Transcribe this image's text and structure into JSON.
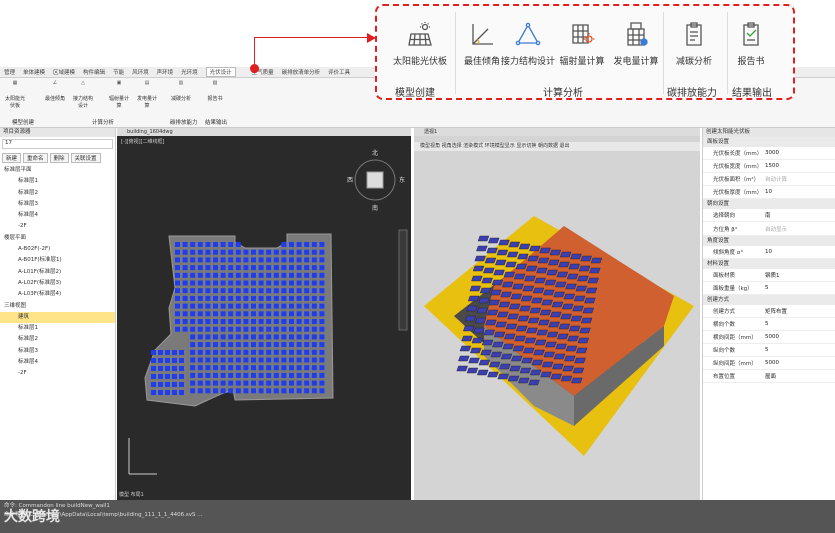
{
  "tabs": [
    "管理",
    "单体建模",
    "区域建模",
    "构件编辑",
    "节能",
    "风环境",
    "声环境",
    "光环境",
    "光伏设计",
    "",
    "室气质量",
    "碳排放清单分析",
    "评价工具"
  ],
  "ribbon": {
    "buttons": [
      "太阳能光伏板",
      "最佳倾角",
      "接力结构设计",
      "辐射量计算",
      "发电量计算",
      "减碳分析",
      "报告书"
    ],
    "groups": [
      "模型创建",
      "计算分析",
      "碳排放能力",
      "结果输出"
    ]
  },
  "zoom": {
    "buttons": [
      "太阳能光伏板",
      "最佳倾角",
      "接力结构设计",
      "辐射量计算",
      "发电量计算",
      "减碳分析",
      "报告书"
    ],
    "groups": [
      "模型创建",
      "计算分析",
      "碳排放能力",
      "结果输出"
    ]
  },
  "left": {
    "title": "项目资源器",
    "field": "17",
    "btns": [
      "新建",
      "重命名",
      "删除",
      "关联设置"
    ],
    "tree": [
      "标准层平面",
      "标准层1",
      "标准层2",
      "标准层3",
      "标准层4",
      "-2F",
      "楼层平面",
      "A-B02F(-2F)",
      "A-B01F(标准层1)",
      "A-L01F(标准层2)",
      "A-L02F(标准层3)",
      "A-L03F(标准层4)",
      "三维视图",
      "建筑",
      "标准层1",
      "标准层2",
      "标准层3",
      "标准层4",
      "-2F"
    ]
  },
  "view2d": {
    "tab": "building_1604dwg",
    "label": "[-][俯视][二维线框]",
    "compass": {
      "n": "北",
      "s": "南",
      "w": "西",
      "e": "东",
      "c": "上"
    },
    "bottom": "模型  布局1"
  },
  "view3d": {
    "tab": "透视1",
    "toolbar": "模型视角  视角选择  渲染模式  环境模型显示  显示切换  朝向数据  退出"
  },
  "right": {
    "title": "创建太阳能光伏板",
    "sections": [
      {
        "name": "面板设置",
        "rows": [
          [
            "光伏板长度（mm）",
            "3000"
          ],
          [
            "光伏板宽度（mm）",
            "1500"
          ],
          [
            "光伏板面积（m²）",
            "自动计算"
          ],
          [
            "光伏板厚度（mm）",
            "10"
          ]
        ]
      },
      {
        "name": "朝向设置",
        "rows": [
          [
            "选择朝向",
            "南"
          ],
          [
            "方位角 β°",
            "自动显示"
          ]
        ]
      },
      {
        "name": "角度设置",
        "rows": [
          [
            "倾斜角度 α°",
            "10"
          ]
        ]
      },
      {
        "name": "材料设置",
        "rows": [
          [
            "面板材质",
            "钢质1"
          ],
          [
            "面板重量（kg）",
            "5"
          ]
        ]
      },
      {
        "name": "创建方式",
        "rows": [
          [
            "创建方式",
            "矩阵布置"
          ],
          [
            "横向个数",
            "5"
          ],
          [
            "横向间距（mm）",
            "5000"
          ],
          [
            "纵向个数",
            "5"
          ],
          [
            "纵向间距（mm）",
            "5000"
          ],
          [
            "布置位置",
            "屋面"
          ]
        ]
      }
    ]
  },
  "cmd": {
    "line1": "命令: Commandon line buildNew_wall1",
    "line2": "命令导航:  C:\\Users\\...\\AppData\\Local\\temp\\building_111_1_1_4406.svS ..."
  },
  "brand": "大数跨境"
}
